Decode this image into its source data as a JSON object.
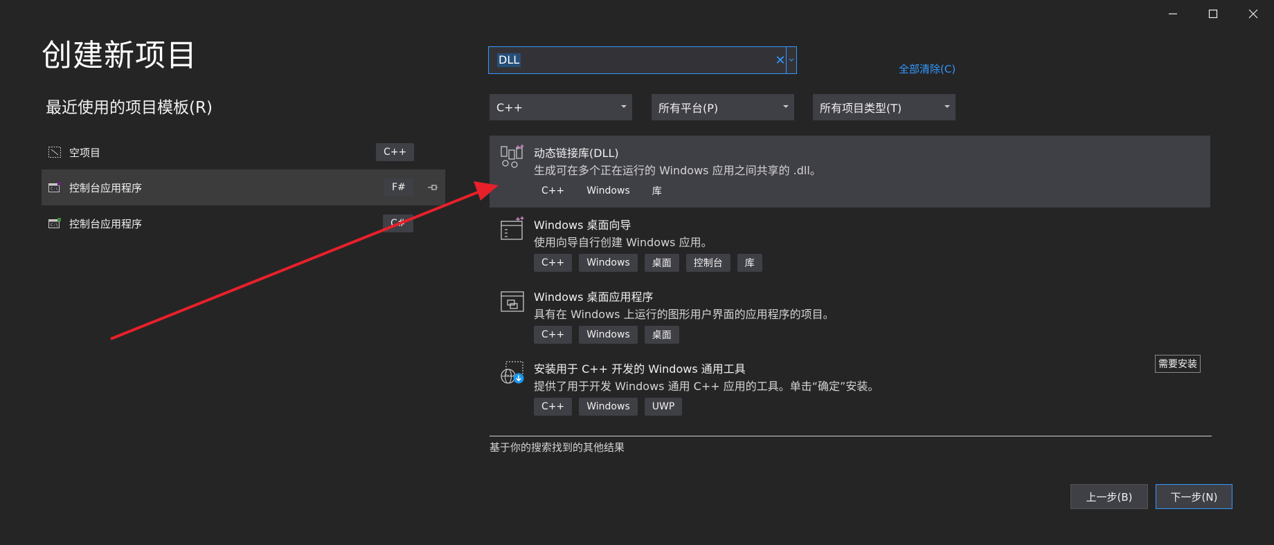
{
  "window": {
    "controls": [
      "minimize-icon",
      "maximize-icon",
      "close-icon"
    ]
  },
  "page": {
    "title": "创建新项目",
    "recent_heading": "最近使用的项目模板(R)"
  },
  "recent_templates": [
    {
      "label": "空项目",
      "lang": "C++",
      "icon": "empty-project-icon"
    },
    {
      "label": "控制台应用程序",
      "lang": "F#",
      "icon": "console-app-icon"
    },
    {
      "label": "控制台应用程序",
      "lang": "C#",
      "icon": "console-app-icon"
    }
  ],
  "search": {
    "value": "DLL",
    "clear_all": "全部清除(C)"
  },
  "filters": {
    "language": "C++",
    "platform": "所有平台(P)",
    "project_type": "所有项目类型(T)"
  },
  "results": [
    {
      "title": "动态链接库(DLL)",
      "desc": "生成可在多个正在运行的 Windows 应用之间共享的 .dll。",
      "tags": [
        "C++",
        "Windows",
        "库"
      ],
      "icon": "dll-library-icon"
    },
    {
      "title": "Windows 桌面向导",
      "desc": "使用向导自行创建 Windows 应用。",
      "tags": [
        "C++",
        "Windows",
        "桌面",
        "控制台",
        "库"
      ],
      "icon": "desktop-wizard-icon"
    },
    {
      "title": "Windows 桌面应用程序",
      "desc": "具有在 Windows 上运行的图形用户界面的应用程序的项目。",
      "tags": [
        "C++",
        "Windows",
        "桌面"
      ],
      "icon": "desktop-app-icon"
    },
    {
      "title": "安装用于 C++ 开发的 Windows 通用工具",
      "desc": "提供了用于开发 Windows 通用 C++ 应用的工具。单击“确定”安装。",
      "tags": [
        "C++",
        "Windows",
        "UWP"
      ],
      "icon": "uwp-tools-install-icon",
      "badge": "需要安装"
    }
  ],
  "other_results": "基于你的搜索找到的其他结果",
  "buttons": {
    "back": "上一步(B)",
    "next": "下一步(N)"
  },
  "colors": {
    "background": "#252526",
    "accent": "#3399ff",
    "selected_row": "#3f3f46",
    "annotation_arrow": "#e8202a"
  }
}
